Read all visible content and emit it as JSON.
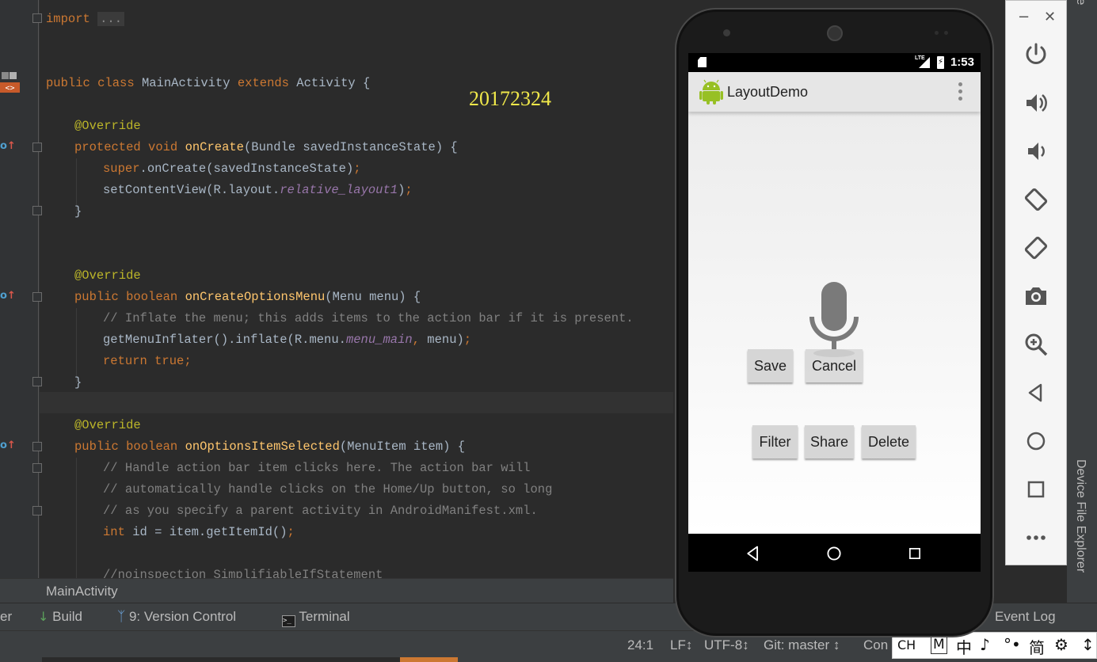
{
  "editor": {
    "code_lines": [
      "import ...",
      "public class MainActivity extends Activity {",
      "@Override",
      "protected void onCreate(Bundle savedInstanceState) {",
      "super.onCreate(savedInstanceState);",
      "setContentView(R.layout.relative_layout1);",
      "}",
      "@Override",
      "public boolean onCreateOptionsMenu(Menu menu) {",
      "// Inflate the menu; this adds items to the action bar if it is present.",
      "getMenuInflater().inflate(R.menu.menu_main, menu);",
      "return true;",
      "}",
      "@Override",
      "public boolean onOptionsItemSelected(MenuItem item) {",
      "// Handle action bar item clicks here. The action bar will",
      "// automatically handle clicks on the Home/Up button, so long",
      "// as you specify a parent activity in AndroidManifest.xml.",
      "int id = item.getItemId();",
      "//noinspection SimplifiableIfStatement"
    ],
    "watermark": "20172324"
  },
  "breadcrumb": "MainActivity",
  "tool_windows": {
    "partial_left": "er",
    "build": "Build",
    "version_control": "9: Version Control",
    "terminal": "Terminal",
    "event_log": "Event Log"
  },
  "status_bar": {
    "position": "24:1",
    "line_separator": "LF↕",
    "encoding": "UTF-8↕",
    "git_branch": "Git: master ↕",
    "partial": "Con"
  },
  "ime": [
    "CH",
    "M",
    "中",
    "♪",
    "°•",
    "简",
    "⚙",
    "↕"
  ],
  "right_edge": {
    "device_file_explorer": "Device File Explorer",
    "top_label": "le"
  },
  "emulator_controls": [
    "power-icon",
    "volume-up-icon",
    "volume-down-icon",
    "rotate-left-icon",
    "rotate-right-icon",
    "camera-icon",
    "zoom-icon",
    "back-icon",
    "home-icon",
    "overview-icon",
    "more-icon"
  ],
  "window_controls": {
    "minimize": "−",
    "close": "✕"
  },
  "phone": {
    "clock": "1:53",
    "network": "LTE",
    "app_title": "LayoutDemo",
    "buttons": {
      "save": "Save",
      "cancel": "Cancel",
      "filter": "Filter",
      "share": "Share",
      "delete": "Delete"
    }
  }
}
